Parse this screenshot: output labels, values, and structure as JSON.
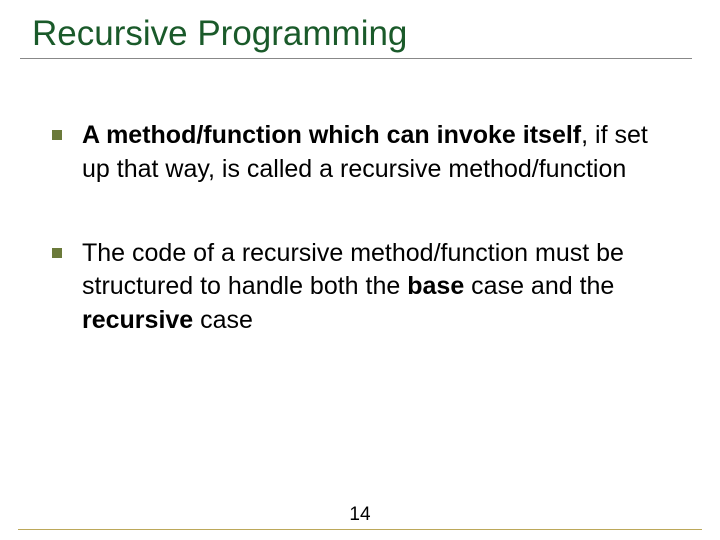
{
  "title": "Recursive Programming",
  "bullets": [
    {
      "pre": "",
      "bold1": "A method/function which can invoke itself",
      "mid1": ", if set up that way, is called a recursive method/function",
      "bold2": "",
      "mid2": "",
      "bold3": "",
      "tail": ""
    },
    {
      "pre": "The code of a recursive method/function must be structured to handle both the ",
      "bold1": "base",
      "mid1": " case and the ",
      "bold2": "recursive",
      "mid2": " case",
      "bold3": "",
      "tail": ""
    }
  ],
  "page_number": "14"
}
